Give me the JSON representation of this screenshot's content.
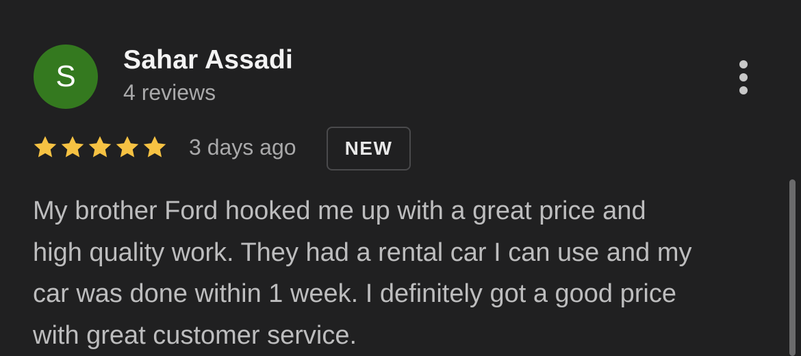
{
  "reviewer": {
    "initial": "S",
    "name": "Sahar Assadi",
    "reviews_count": "4 reviews",
    "avatar_color": "#34791f"
  },
  "menu_icon": "more-vert-icon",
  "rating": {
    "stars": 5,
    "max_stars": 5,
    "star_color": "#f6c243",
    "star_icon": "star-icon"
  },
  "posted": "3 days ago",
  "badge": "NEW",
  "review_lines": [
    "My brother Ford hooked me up with a great price and",
    "high quality work. They had a rental car I can use and my",
    "car was done within 1 week. I definitely got a good price",
    "with great customer service."
  ]
}
